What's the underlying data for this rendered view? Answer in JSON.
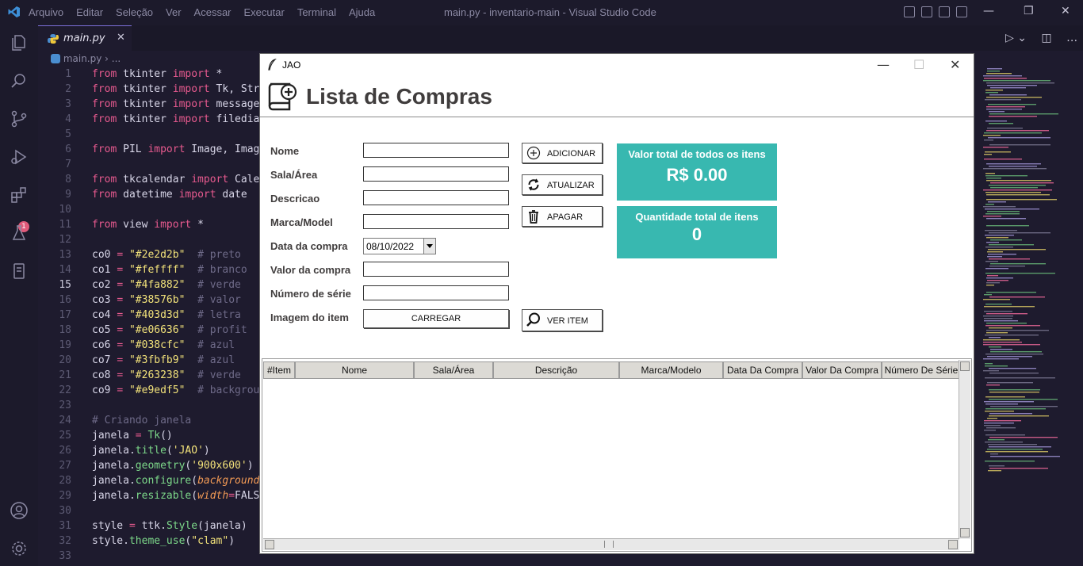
{
  "vscode": {
    "menu": [
      "Arquivo",
      "Editar",
      "Seleção",
      "Ver",
      "Acessar",
      "Executar",
      "Terminal",
      "Ajuda"
    ],
    "window_title": "main.py - inventario-main - Visual Studio Code",
    "tab_label": "main.py",
    "breadcrumb": "main.py › ...",
    "badge_count": "1",
    "colors": {
      "background": "#1e1b2e",
      "sidebar": "#1c1a2b",
      "keyword": "#e85a8f",
      "string": "#f2e27a",
      "comment": "#6e6a88"
    }
  },
  "code_lines": [
    {
      "n": "1",
      "html": [
        [
          "kw",
          "from"
        ],
        [
          "t",
          " tkinter "
        ],
        [
          "kw",
          "import"
        ],
        [
          "t",
          " *"
        ]
      ]
    },
    {
      "n": "2",
      "html": [
        [
          "kw",
          "from"
        ],
        [
          "t",
          " tkinter "
        ],
        [
          "kw",
          "import"
        ],
        [
          "t",
          " Tk, Stri"
        ]
      ]
    },
    {
      "n": "3",
      "html": [
        [
          "kw",
          "from"
        ],
        [
          "t",
          " tkinter "
        ],
        [
          "kw",
          "import"
        ],
        [
          "t",
          " messageb"
        ]
      ]
    },
    {
      "n": "4",
      "html": [
        [
          "kw",
          "from"
        ],
        [
          "t",
          " tkinter "
        ],
        [
          "kw",
          "import"
        ],
        [
          "t",
          " filedial"
        ]
      ]
    },
    {
      "n": "5",
      "html": []
    },
    {
      "n": "6",
      "html": [
        [
          "kw",
          "from"
        ],
        [
          "t",
          " PIL "
        ],
        [
          "kw",
          "import"
        ],
        [
          "t",
          " Image, Image"
        ]
      ]
    },
    {
      "n": "7",
      "html": []
    },
    {
      "n": "8",
      "html": [
        [
          "kw",
          "from"
        ],
        [
          "t",
          " tkcalendar "
        ],
        [
          "kw",
          "import"
        ],
        [
          "t",
          " Caler"
        ]
      ]
    },
    {
      "n": "9",
      "html": [
        [
          "kw",
          "from"
        ],
        [
          "t",
          " datetime "
        ],
        [
          "kw",
          "import"
        ],
        [
          "t",
          " date"
        ]
      ]
    },
    {
      "n": "10",
      "html": []
    },
    {
      "n": "11",
      "html": [
        [
          "kw",
          "from"
        ],
        [
          "t",
          " view "
        ],
        [
          "kw",
          "import"
        ],
        [
          "t",
          " *"
        ]
      ]
    },
    {
      "n": "12",
      "html": []
    },
    {
      "n": "13",
      "html": [
        [
          "t",
          "co0 "
        ],
        [
          "kw",
          "="
        ],
        [
          "t",
          " "
        ],
        [
          "st",
          "\"#2e2d2b\""
        ],
        [
          "t",
          "  "
        ],
        [
          "cm",
          "# preto"
        ]
      ]
    },
    {
      "n": "14",
      "html": [
        [
          "t",
          "co1 "
        ],
        [
          "kw",
          "="
        ],
        [
          "t",
          " "
        ],
        [
          "st",
          "\"#feffff\""
        ],
        [
          "t",
          "  "
        ],
        [
          "cm",
          "# branco"
        ]
      ]
    },
    {
      "n": "15",
      "html": [
        [
          "t",
          "co2 "
        ],
        [
          "kw",
          "="
        ],
        [
          "t",
          " "
        ],
        [
          "st",
          "\"#4fa882\""
        ],
        [
          "t",
          "  "
        ],
        [
          "cm",
          "# verde"
        ]
      ]
    },
    {
      "n": "16",
      "html": [
        [
          "t",
          "co3 "
        ],
        [
          "kw",
          "="
        ],
        [
          "t",
          " "
        ],
        [
          "st",
          "\"#38576b\""
        ],
        [
          "t",
          "  "
        ],
        [
          "cm",
          "# valor"
        ]
      ]
    },
    {
      "n": "17",
      "html": [
        [
          "t",
          "co4 "
        ],
        [
          "kw",
          "="
        ],
        [
          "t",
          " "
        ],
        [
          "st",
          "\"#403d3d\""
        ],
        [
          "t",
          "  "
        ],
        [
          "cm",
          "# letra"
        ]
      ]
    },
    {
      "n": "18",
      "html": [
        [
          "t",
          "co5 "
        ],
        [
          "kw",
          "="
        ],
        [
          "t",
          " "
        ],
        [
          "st",
          "\"#e06636\""
        ],
        [
          "t",
          "  "
        ],
        [
          "cm",
          "# profit"
        ]
      ]
    },
    {
      "n": "19",
      "html": [
        [
          "t",
          "co6 "
        ],
        [
          "kw",
          "="
        ],
        [
          "t",
          " "
        ],
        [
          "st",
          "\"#038cfc\""
        ],
        [
          "t",
          "  "
        ],
        [
          "cm",
          "# azul"
        ]
      ]
    },
    {
      "n": "20",
      "html": [
        [
          "t",
          "co7 "
        ],
        [
          "kw",
          "="
        ],
        [
          "t",
          " "
        ],
        [
          "st",
          "\"#3fbfb9\""
        ],
        [
          "t",
          "  "
        ],
        [
          "cm",
          "# azul"
        ]
      ]
    },
    {
      "n": "21",
      "html": [
        [
          "t",
          "co8 "
        ],
        [
          "kw",
          "="
        ],
        [
          "t",
          " "
        ],
        [
          "st",
          "\"#263238\""
        ],
        [
          "t",
          "  "
        ],
        [
          "cm",
          "# verde"
        ]
      ]
    },
    {
      "n": "22",
      "html": [
        [
          "t",
          "co9 "
        ],
        [
          "kw",
          "="
        ],
        [
          "t",
          " "
        ],
        [
          "st",
          "\"#e9edf5\""
        ],
        [
          "t",
          "  "
        ],
        [
          "cm",
          "# backgrour"
        ]
      ]
    },
    {
      "n": "23",
      "html": []
    },
    {
      "n": "24",
      "html": [
        [
          "cm",
          "# Criando janela"
        ]
      ]
    },
    {
      "n": "25",
      "html": [
        [
          "t",
          "janela "
        ],
        [
          "kw",
          "="
        ],
        [
          "t",
          " "
        ],
        [
          "fn",
          "Tk"
        ],
        [
          "t",
          "()"
        ]
      ]
    },
    {
      "n": "26",
      "html": [
        [
          "t",
          "janela."
        ],
        [
          "fn",
          "title"
        ],
        [
          "t",
          "("
        ],
        [
          "st",
          "'JAO'"
        ],
        [
          "t",
          ")"
        ]
      ]
    },
    {
      "n": "27",
      "html": [
        [
          "t",
          "janela."
        ],
        [
          "fn",
          "geometry"
        ],
        [
          "t",
          "("
        ],
        [
          "st",
          "'900x600'"
        ],
        [
          "t",
          ")"
        ]
      ]
    },
    {
      "n": "28",
      "html": [
        [
          "t",
          "janela."
        ],
        [
          "fn",
          "configure"
        ],
        [
          "t",
          "("
        ],
        [
          "pm",
          "background"
        ],
        [
          "kw",
          "="
        ]
      ]
    },
    {
      "n": "29",
      "html": [
        [
          "t",
          "janela."
        ],
        [
          "fn",
          "resizable"
        ],
        [
          "t",
          "("
        ],
        [
          "pm",
          "width"
        ],
        [
          "kw",
          "="
        ],
        [
          "t",
          "FALSE"
        ]
      ]
    },
    {
      "n": "30",
      "html": []
    },
    {
      "n": "31",
      "html": [
        [
          "t",
          "style "
        ],
        [
          "kw",
          "="
        ],
        [
          "t",
          " ttk."
        ],
        [
          "fn",
          "Style"
        ],
        [
          "t",
          "(janela)"
        ]
      ]
    },
    {
      "n": "32",
      "html": [
        [
          "t",
          "style."
        ],
        [
          "fn",
          "theme_use"
        ],
        [
          "t",
          "("
        ],
        [
          "st",
          "\"clam\""
        ],
        [
          "t",
          ")"
        ]
      ]
    },
    {
      "n": "33",
      "html": []
    }
  ],
  "current_line": "15",
  "app": {
    "window_title": "JAO",
    "heading": "Lista de Compras",
    "labels": {
      "nome": "Nome",
      "sala": "Sala/Área",
      "descricao": "Descricao",
      "marca": "Marca/Model",
      "data": "Data da compra",
      "valor": "Valor da compra",
      "serie": "Número de série",
      "imagem": "Imagem do item"
    },
    "date_value": "08/10/2022",
    "buttons": {
      "carregar": "CARREGAR",
      "adicionar": "ADICIONAR",
      "atualizar": "ATUALIZAR",
      "apagar": "APAGAR",
      "ver_item": "VER ITEM"
    },
    "cards": {
      "total_title": "Valor total de todos os itens",
      "total_value": "R$ 0.00",
      "qty_title": "Quantidade total de itens",
      "qty_value": "0",
      "color": "#38b8b0"
    },
    "table_headers": [
      "#Item",
      "Nome",
      "Sala/Área",
      "Descrição",
      "Marca/Modelo",
      "Data Da Compra",
      "Valor Da Compra",
      "Número De Série"
    ]
  }
}
